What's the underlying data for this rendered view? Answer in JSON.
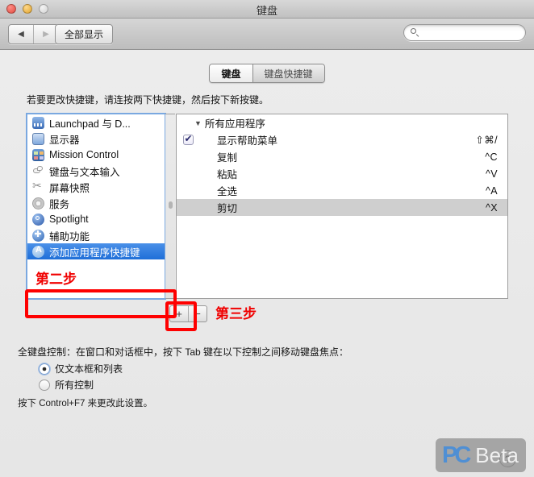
{
  "window": {
    "title": "键盘",
    "traffic_lights": [
      "close",
      "minimize",
      "zoom"
    ]
  },
  "toolbar": {
    "back_icon": "◀",
    "forward_icon": "▶",
    "show_all_label": "全部显示",
    "search_placeholder": "",
    "search_value": ""
  },
  "tabs": [
    {
      "label": "键盘",
      "active": true
    },
    {
      "label": "键盘快捷键",
      "active": false
    }
  ],
  "hint": "若要更改快捷键，请连按两下快捷键，然后按下新按键。",
  "categories": [
    {
      "label": "Launchpad 与 D...",
      "icon": "launchpad-icon",
      "selected": false
    },
    {
      "label": "显示器",
      "icon": "display-icon",
      "selected": false
    },
    {
      "label": "Mission Control",
      "icon": "mission-control-icon",
      "selected": false
    },
    {
      "label": "键盘与文本输入",
      "icon": "keyboard-icon",
      "selected": false
    },
    {
      "label": "屏幕快照",
      "icon": "screenshot-icon",
      "selected": false
    },
    {
      "label": "服务",
      "icon": "services-gear-icon",
      "selected": false
    },
    {
      "label": "Spotlight",
      "icon": "spotlight-icon",
      "selected": false
    },
    {
      "label": "辅助功能",
      "icon": "accessibility-icon",
      "selected": false
    },
    {
      "label": "添加应用程序快捷键",
      "icon": "app-store-icon",
      "selected": true
    }
  ],
  "shortcuts": {
    "group_label": "所有应用程序",
    "disclosure_icon": "▼",
    "rows": [
      {
        "name": "显示帮助菜单",
        "key": "⇧⌘/",
        "checked": true,
        "selected": false
      },
      {
        "name": "复制",
        "key": "^C",
        "checked": false,
        "selected": false
      },
      {
        "name": "粘贴",
        "key": "^V",
        "checked": false,
        "selected": false
      },
      {
        "name": "全选",
        "key": "^A",
        "checked": false,
        "selected": false
      },
      {
        "name": "剪切",
        "key": "^X",
        "checked": false,
        "selected": true
      }
    ]
  },
  "list_buttons": {
    "add_label": "+",
    "remove_label": "−"
  },
  "annotations": {
    "step2": "第二步",
    "step3": "第三步",
    "color": "#fe0000"
  },
  "full_keyboard_access": {
    "label": "全键盘控制：在窗口和对话框中，按下 Tab 键在以下控制之间移动键盘焦点：",
    "options": [
      {
        "label": "仅文本框和列表",
        "selected": true
      },
      {
        "label": "所有控制",
        "selected": false
      }
    ],
    "note": "按下 Control+F7 来更改此设置。"
  },
  "help_button": {
    "label": "?"
  },
  "watermark": {
    "pc": "PC",
    "beta": "Beta"
  }
}
